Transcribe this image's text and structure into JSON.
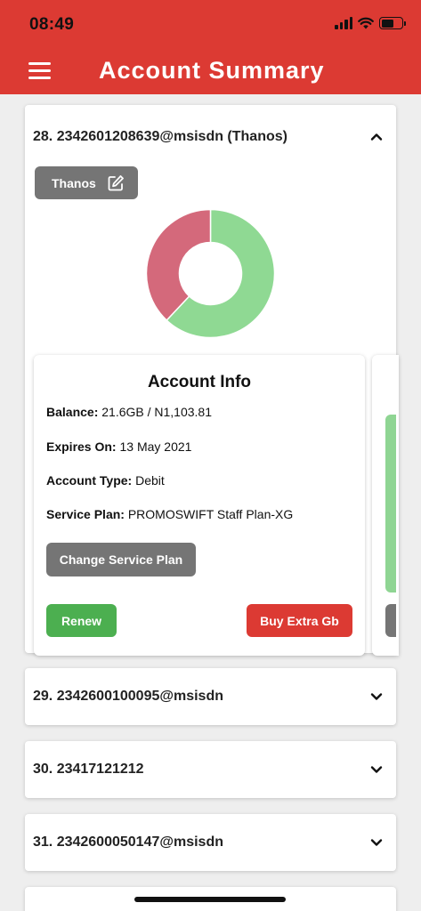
{
  "status_bar": {
    "time": "08:49"
  },
  "header": {
    "title": "Account Summary"
  },
  "accounts": [
    {
      "title": "28. 2342601208639@msisdn (Thanos)",
      "expanded": true,
      "nickname": "Thanos",
      "usage": {
        "used_fraction": 0.38,
        "remaining_fraction": 0.62,
        "used_color": "#d4697b",
        "remaining_color": "#8fd993"
      },
      "info": {
        "heading": "Account Info",
        "balance_label": "Balance:",
        "balance_value": "21.6GB / N1,103.81",
        "expires_label": "Expires On:",
        "expires_value": "13 May 2021",
        "type_label": "Account Type:",
        "type_value": "Debit",
        "plan_label": "Service Plan:",
        "plan_value": "PROMOSWIFT Staff Plan-XG",
        "change_plan_label": "Change Service Plan",
        "renew_label": "Renew",
        "extra_label": "Buy Extra Gb"
      }
    },
    {
      "title": "29. 2342600100095@msisdn",
      "expanded": false
    },
    {
      "title": "30. 23417121212",
      "expanded": false
    },
    {
      "title": "31. 2342600050147@msisdn",
      "expanded": false
    }
  ],
  "colors": {
    "brand_red": "#dc3a33",
    "green": "#4caf50",
    "grey_button": "#757575"
  }
}
